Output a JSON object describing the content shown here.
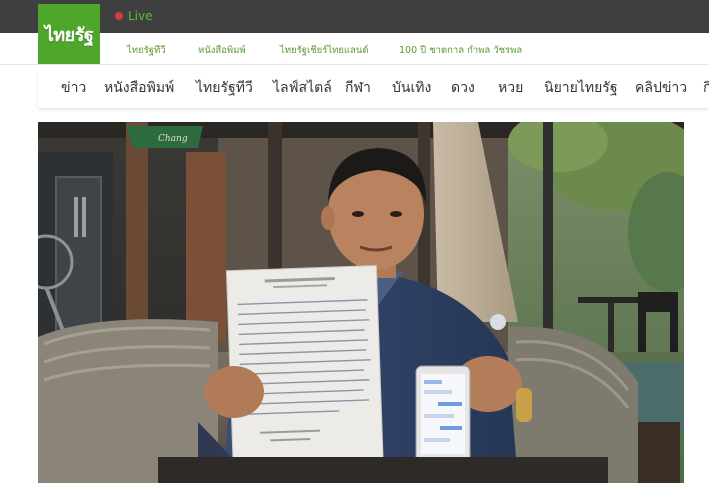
{
  "topbar": {
    "live_label": "Live"
  },
  "logo": {
    "text": "ไทยรัฐ"
  },
  "subnav": {
    "links": [
      "ไทยรัฐทีวี",
      "หนังสือพิมพ์",
      "ไทยรัฐเชียร์ไทยแลนด์",
      "100 ปี ชาตกาล กำพล วัชรพล"
    ]
  },
  "mainnav": {
    "items": [
      "ข่าว",
      "หนังสือพิมพ์",
      "ไทยรัฐทีวี",
      "ไลฟ์สไตล์",
      "กีฬา",
      "บันเทิง",
      "ดวง",
      "หวย",
      "นิยายไทยรัฐ",
      "คลิปข่าว",
      "กิ"
    ]
  },
  "photo": {
    "sign_text": "Chang"
  },
  "colors": {
    "brand_green": "#4ea62b",
    "topbar_dark": "#3f3f3f",
    "link_green": "#5a9c2f",
    "live_dot": "#d63b3b"
  }
}
